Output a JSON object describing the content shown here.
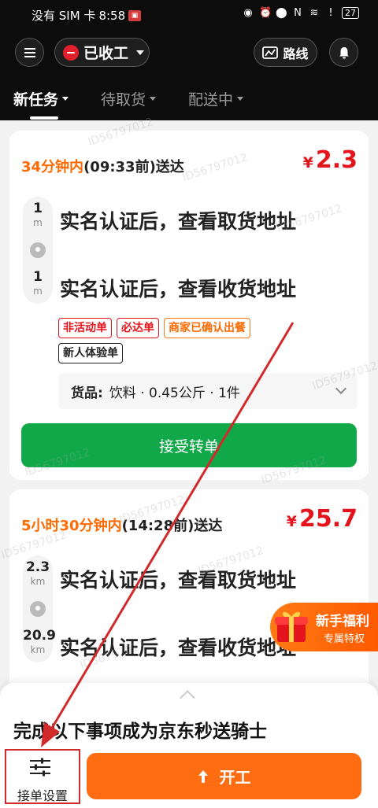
{
  "statusbar": {
    "carrier": "没有 SIM 卡",
    "time": "8:58",
    "battery": "27"
  },
  "header": {
    "work_status": "已收工",
    "route_label": "路线"
  },
  "tabs": [
    {
      "label": "新任务",
      "active": true
    },
    {
      "label": "待取货",
      "active": false
    },
    {
      "label": "配送中",
      "active": false
    }
  ],
  "orders": [
    {
      "deadline_highlight": "34分钟内",
      "deadline_rest": "(09:33前)送达",
      "currency": "¥",
      "price": "2.3",
      "pickup_distance": "1",
      "pickup_unit": "m",
      "pickup_text": "实名认证后，查看取货地址",
      "delivery_distance": "1",
      "delivery_unit": "m",
      "delivery_text": "实名认证后，查看收货地址",
      "tags": [
        {
          "text": "非活动单",
          "style": "red"
        },
        {
          "text": "必达单",
          "style": "red"
        },
        {
          "text": "商家已确认出餐",
          "style": "orange"
        },
        {
          "text": "新人体验单",
          "style": "black"
        }
      ],
      "goods_label": "货品:",
      "goods_value": "饮料 · 0.45公斤 · 1件",
      "action": "接受转单"
    },
    {
      "deadline_highlight": "5小时30分钟内",
      "deadline_rest": "(14:28前)送达",
      "currency": "¥",
      "price": "25.7",
      "pickup_distance": "2.3",
      "pickup_unit": "km",
      "pickup_text": "实名认证后，查看取货地址",
      "delivery_distance": "20.9",
      "delivery_unit": "km",
      "delivery_text": "实名认证后，查看收货地址"
    }
  ],
  "promo": {
    "title": "新手福利",
    "subtitle": "专属特权"
  },
  "sheet": {
    "title": "完成以下事项成为京东秒送骑士"
  },
  "bottom": {
    "settings_label": "接单设置",
    "start_label": "开工"
  },
  "watermark": "ID56797012",
  "colors": {
    "accent_orange": "#ff6d12",
    "price_red": "#e3141c",
    "accept_green": "#11a84a",
    "annotation_red": "#d12a2a"
  }
}
